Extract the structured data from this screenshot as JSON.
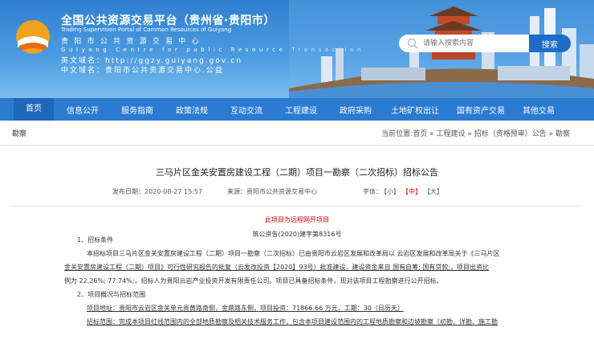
{
  "header": {
    "title_cn": "全国公共资源交易平台（贵州省·贵阳市）",
    "title_en": "Trading Supervision Portal of Common Resources of Guiyang",
    "centre_cn": "贵 阳 市 公 共 资 源 交 易 中 心",
    "centre_en": "Guiyang   Centre   for   public   Resource   Transaction",
    "domain_en_label": "英文域名：",
    "domain_en_value": "http://ggzy.guiyang.gov.cn",
    "domain_cn_label": "中文域名：",
    "domain_cn_value": "贵阳市公共资源交易中心.公益"
  },
  "search": {
    "placeholder": "请输入搜索内容",
    "button": "搜索"
  },
  "nav": [
    "首页",
    "信息公开",
    "服务指南",
    "政策法规",
    "互动交流",
    "工程建设",
    "政府采购",
    "土地矿权出让",
    "国有资产交易",
    "其他交易"
  ],
  "breadcrumb": {
    "section": "勘察",
    "location": "当前位置:首页 » 工程建设 » 招标（资格预审）公告 » 勘察"
  },
  "article": {
    "title": "三马片区金关安置房建设工程（二期）项目一勘察（二次招标）招标公告",
    "date": "发布日期：2020-08-27 15:57",
    "source": "来源：贵阳市公共资源交易中心",
    "font_label": "字体：",
    "font_small": "【小】",
    "font_medium": "【中】",
    "font_large": "【大】",
    "notice": "此项目为远程网开项目",
    "doc_no": "筑公资告(2020)建字第8316号",
    "lines": [
      "1、招标条件",
      "本招标项目三马片区金关安置房建设工程（二期）项目一勘察（二次招标）已由贵阳市云岩区发展和改革局以 云岩区发展和改革局关于《三马片区",
      "金关安置房建设工程（二期）项目》可行性研究报告的批复（云发改投资【2020】93号）批准建设，建设资金来自 国有自筹; 国有贷款;，项目出资比",
      "例为 22.26%; 77.74%;，招标人为贵阳云岩产业投资开发有限责任公司。项目已具备招标条件，现对该项目工程勘察进行公开招标。",
      "2、项目概况与招标范围",
      "项目地址：贵阳市云岩区金关单元贵黄路南侧，金鼎路东侧，项目投资：71866.66 万元，工期：30（日历天）",
      "招标范围：完成本项目红线范围内的全部地质勘察及相关技术服务工作，包含本项目建设范围内的工程地质勘察和边坡勘察（初勘、详勘、施工勘"
    ]
  },
  "colors": {
    "header_blue": "#2f7fd0",
    "nav_blue": "#2b7bd3",
    "nav_active": "#1f67bb",
    "alert_red": "#dd0000"
  }
}
